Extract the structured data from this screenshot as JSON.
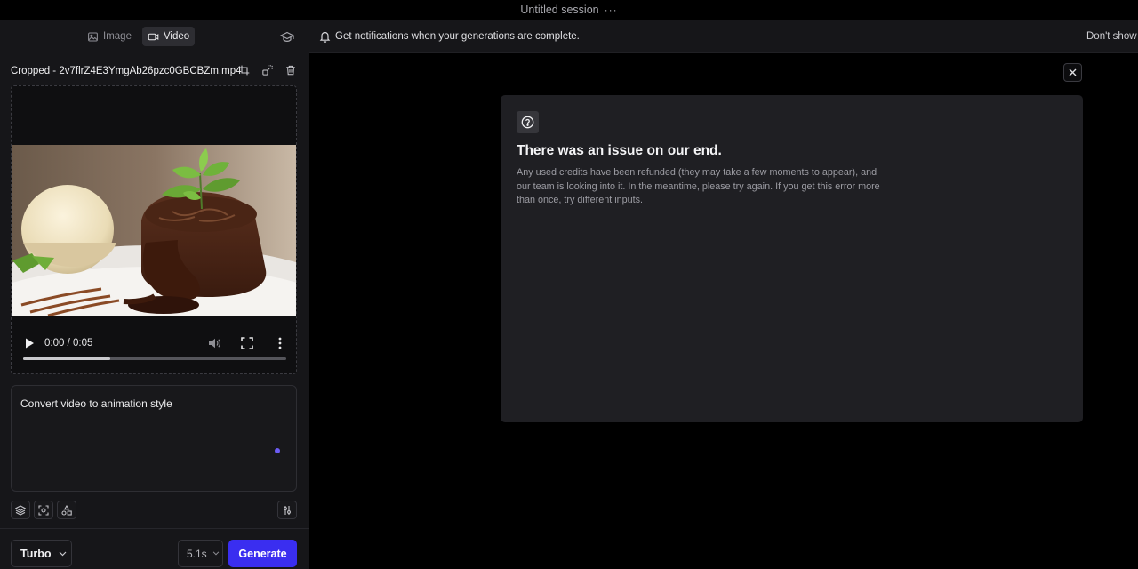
{
  "header": {
    "session_title": "Untitled session",
    "more_label": "···"
  },
  "sidebar": {
    "tabs": [
      {
        "label": "Image",
        "icon": "image-icon",
        "active": false
      },
      {
        "label": "Video",
        "icon": "video-icon",
        "active": true
      }
    ],
    "file_name": "Cropped - 2v7flrZ4E3YmgAb26pzc0GBCBZm.mp4",
    "video": {
      "current_time": "0:00",
      "separator": "/",
      "duration": "0:05",
      "progress": 0.33
    },
    "prompt_text": "Convert video to animation style",
    "model_label": "Turbo",
    "duration_label": "5.1s",
    "generate_label": "Generate"
  },
  "notification": {
    "text": "Get notifications when your generations are complete.",
    "dismiss_label": "Don't show a"
  },
  "error": {
    "title": "There was an issue on our end.",
    "body": "Any used credits have been refunded (they may take a few moments to appear), and our team is looking into it. In the meantime, please try again. If you get this error more than once, try different inputs."
  },
  "colors": {
    "accent": "#3a2ef0",
    "prompt_dot": "#6c5cf4",
    "card_bg": "#1f1f23",
    "sidebar_bg": "#161619"
  }
}
